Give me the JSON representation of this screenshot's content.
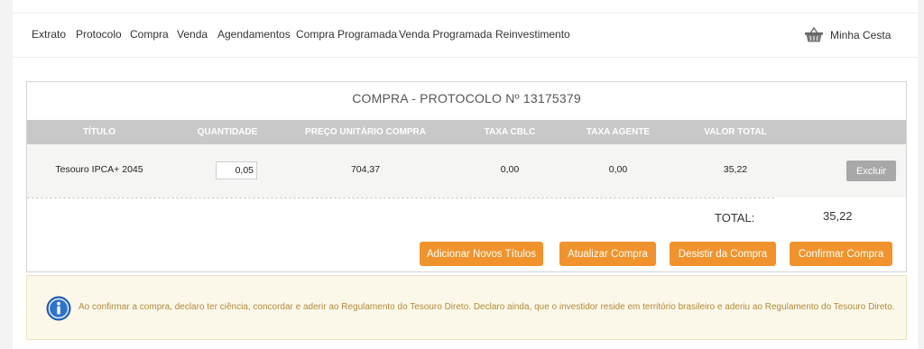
{
  "nav": {
    "items": [
      {
        "label": "Extrato"
      },
      {
        "label": "Protocolo"
      },
      {
        "label": "Compra"
      },
      {
        "label": "Venda"
      },
      {
        "label": "Agendamentos"
      },
      {
        "label": "Compra Programada"
      },
      {
        "label": "Venda Programada"
      },
      {
        "label": "Reinvestimento"
      }
    ],
    "cart_label": "Minha Cesta"
  },
  "card": {
    "title": "COMPRA - PROTOCOLO Nº 13175379",
    "columns": [
      "TÍTULO",
      "QUANTIDADE",
      "PREÇO UNITÁRIO COMPRA",
      "TAXA CBLC",
      "TAXA AGENTE",
      "VALOR TOTAL"
    ],
    "row": {
      "titulo": "Tesouro IPCA+ 2045",
      "quantidade": "0,05",
      "preco_unitario": "704,37",
      "taxa_cblc": "0,00",
      "taxa_agente": "0,00",
      "valor_total": "35,22",
      "delete_label": "Excluir"
    },
    "total_label": "TOTAL:",
    "total_value": "35,22",
    "buttons": {
      "add": "Adicionar Novos Títulos",
      "update": "Atualizar Compra",
      "cancel": "Desistir da Compra",
      "confirm": "Confirmar Compra"
    }
  },
  "notice": {
    "text": "Ao confirmar a compra, declaro ter ciência, concordar e aderir ao Regulamento do Tesouro Direto. Declaro ainda, que o investidor reside em território brasileiro e aderiu ao Regulamento do Tesouro Direto."
  },
  "colors": {
    "accent": "#f0932c",
    "header_gray": "#c8c8c8",
    "notice_bg": "#fcf8e9",
    "notice_text": "#b08a3c"
  }
}
